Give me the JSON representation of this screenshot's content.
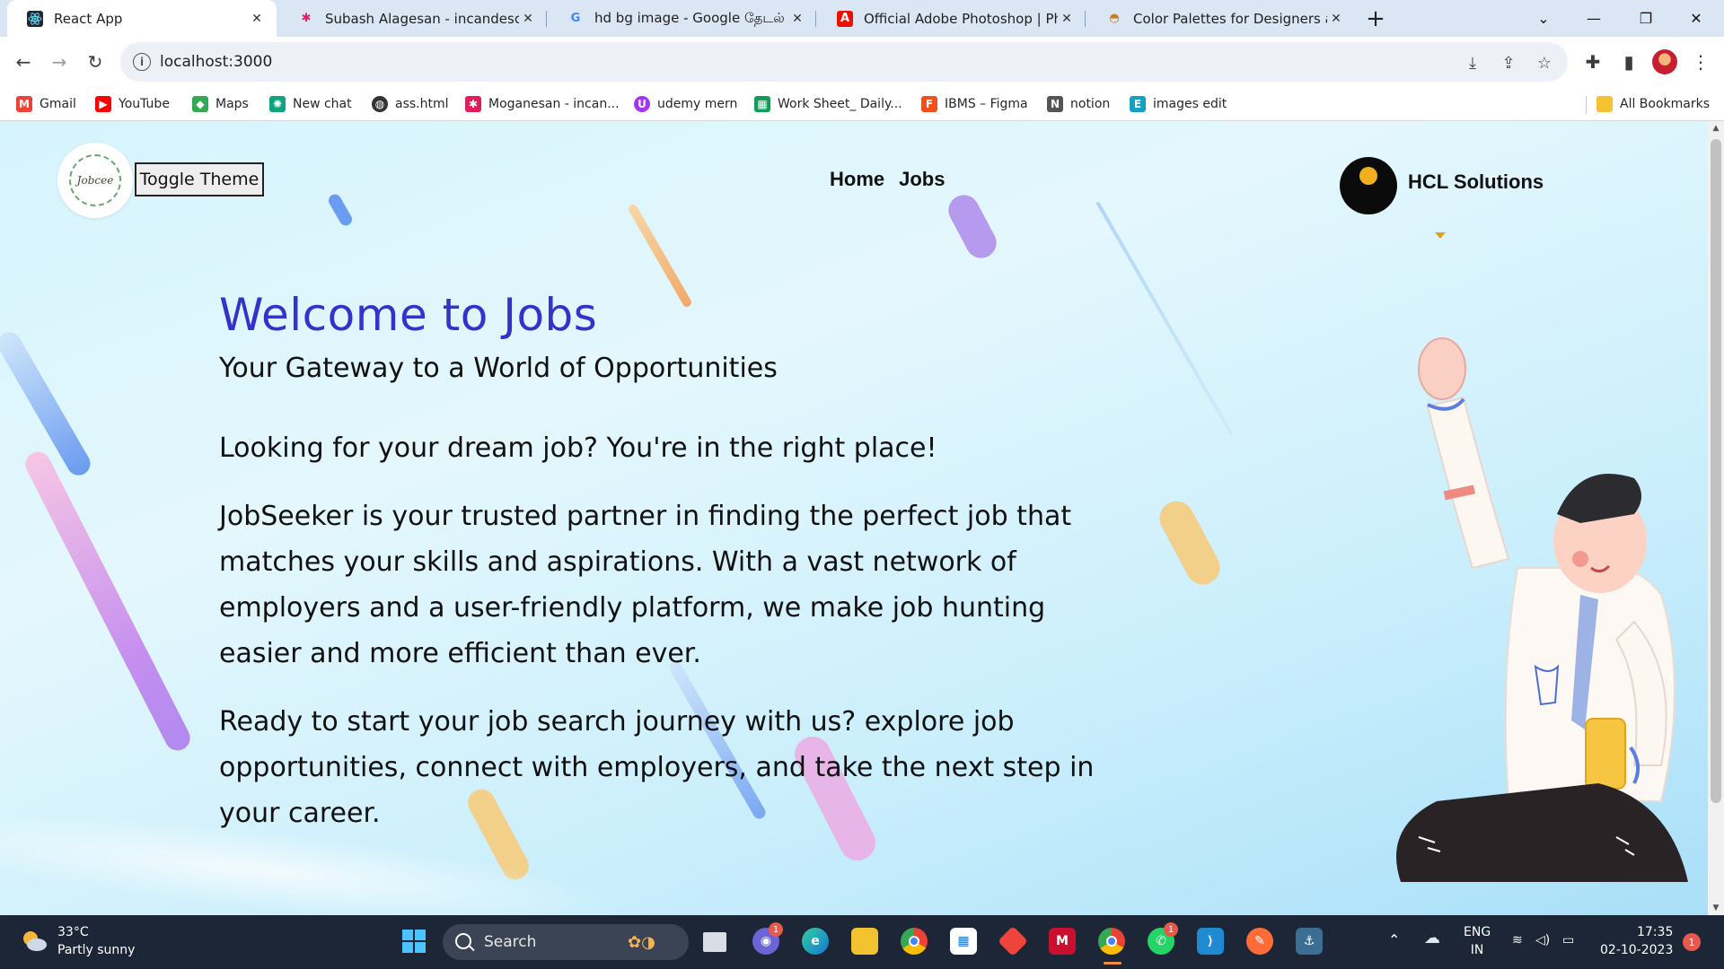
{
  "browser": {
    "tabs": [
      {
        "title": "React App",
        "favicon": "react-icon",
        "active": true
      },
      {
        "title": "Subash Alagesan - incandescent",
        "favicon": "slack-icon",
        "active": false
      },
      {
        "title": "hd bg image - Google தேடல்",
        "favicon": "google-icon",
        "active": false
      },
      {
        "title": "Official Adobe Photoshop | Phot",
        "favicon": "adobe-icon",
        "active": false
      },
      {
        "title": "Color Palettes for Designers and",
        "favicon": "coolors-icon",
        "active": false
      }
    ],
    "new_tab": "+",
    "window_controls": {
      "minimize": "—",
      "maximize": "❐",
      "close": "✕",
      "tab_search": "⌄"
    },
    "address": {
      "url": "localhost:3000",
      "info": "i"
    },
    "bookmarks": [
      {
        "label": "Gmail",
        "icon": "gmail-icon",
        "color": "#ea4335"
      },
      {
        "label": "YouTube",
        "icon": "youtube-icon",
        "color": "#ff0000"
      },
      {
        "label": "Maps",
        "icon": "maps-icon",
        "color": "#34a853"
      },
      {
        "label": "New chat",
        "icon": "chatgpt-icon",
        "color": "#10a37f"
      },
      {
        "label": "ass.html",
        "icon": "globe-icon",
        "color": "#333333"
      },
      {
        "label": "Moganesan - incan...",
        "icon": "slack-icon",
        "color": "#e01e5a"
      },
      {
        "label": "udemy mern",
        "icon": "udemy-icon",
        "color": "#a435f0"
      },
      {
        "label": "Work Sheet_ Daily...",
        "icon": "sheets-icon",
        "color": "#0f9d58"
      },
      {
        "label": "IBMS – Figma",
        "icon": "figma-icon",
        "color": "#f24e1e"
      },
      {
        "label": "notion",
        "icon": "notion-icon",
        "color": "#555555"
      },
      {
        "label": "images edit",
        "icon": "editor-icon",
        "color": "#14a0c4"
      }
    ],
    "all_bookmarks": "All Bookmarks"
  },
  "page": {
    "logo_text": "Jobcee",
    "toggle_theme": "Toggle Theme",
    "nav": [
      {
        "label": "Home"
      },
      {
        "label": "Jobs"
      }
    ],
    "org_name": "HCL Solutions",
    "hero": {
      "title": "Welcome to Jobs",
      "subtitle": "Your Gateway to a World of Opportunities",
      "p1": "Looking for your dream job? You're in the right place!",
      "p2": "JobSeeker is your trusted partner in finding the perfect job that matches your skills and aspirations. With a vast network of employers and a user-friendly platform, we make job hunting easier and more efficient than ever.",
      "p3": "Ready to start your job search journey with us? explore job opportunities, connect with employers, and take the next step in your career."
    },
    "colors": {
      "title": "#3333cc",
      "accent_caret": "#e3a11a"
    }
  },
  "taskbar": {
    "weather": {
      "temp": "33°C",
      "desc": "Partly sunny"
    },
    "search": "Search",
    "apps": [
      {
        "name": "start-icon",
        "badge": ""
      },
      {
        "name": "task-view-icon",
        "badge": ""
      },
      {
        "name": "teams-chat-icon",
        "badge": "1"
      },
      {
        "name": "edge-icon",
        "badge": ""
      },
      {
        "name": "file-explorer-icon",
        "badge": ""
      },
      {
        "name": "chrome-icon",
        "badge": ""
      },
      {
        "name": "microsoft-store-icon",
        "badge": ""
      },
      {
        "name": "anydesk-icon",
        "badge": ""
      },
      {
        "name": "mcafee-icon",
        "badge": ""
      },
      {
        "name": "chrome-profile-icon",
        "badge": ""
      },
      {
        "name": "whatsapp-icon",
        "badge": "1"
      },
      {
        "name": "vscode-icon",
        "badge": ""
      },
      {
        "name": "postman-icon",
        "badge": ""
      },
      {
        "name": "mysql-workbench-icon",
        "badge": ""
      }
    ],
    "tray": {
      "lang1": "ENG",
      "lang2": "IN",
      "time": "17:35",
      "date": "02-10-2023",
      "notifications": "1"
    }
  }
}
